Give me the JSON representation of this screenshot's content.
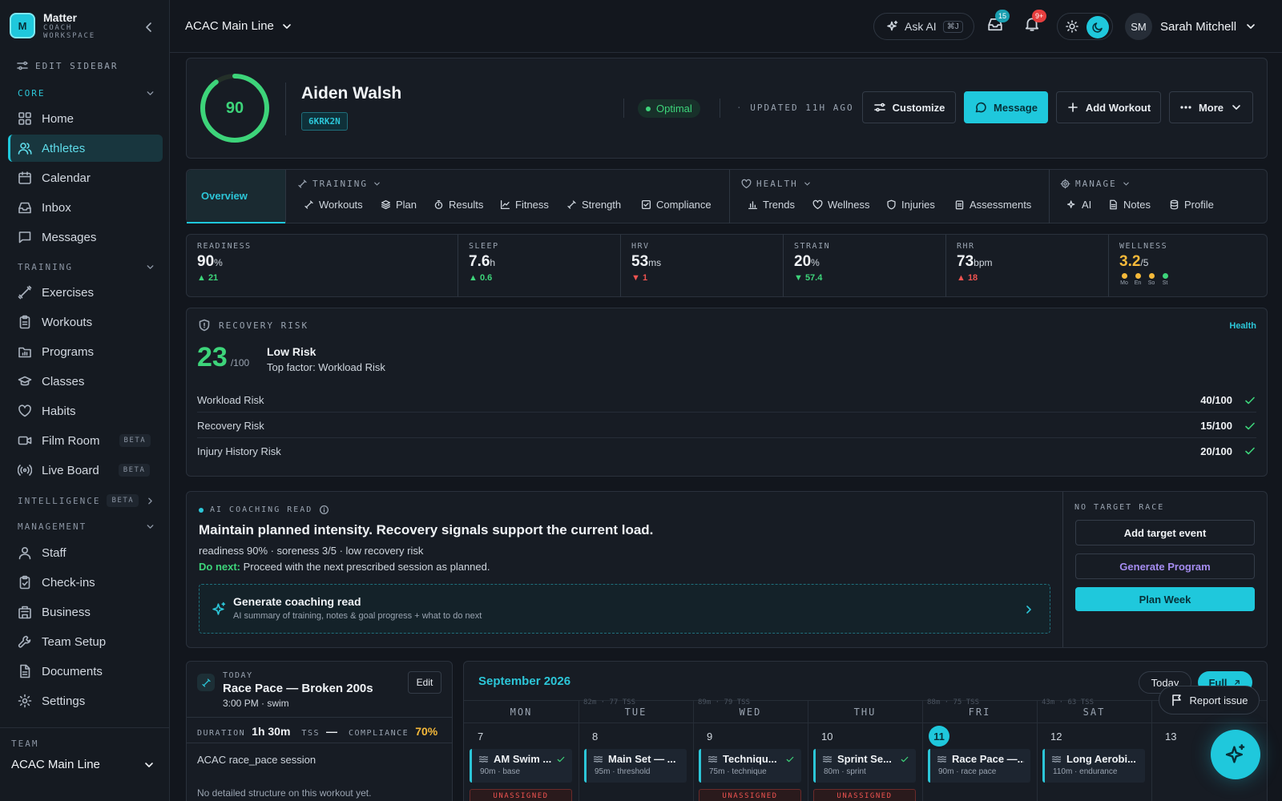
{
  "sidebar": {
    "brand": {
      "logo": "M",
      "name": "Matter",
      "sub1": "COACH",
      "sub2": "WORKSPACE"
    },
    "edit_label": "EDIT SIDEBAR",
    "sections": {
      "core": "CORE",
      "training": "TRAINING",
      "intelligence": "INTELLIGENCE",
      "management": "MANAGEMENT"
    },
    "beta": "BETA",
    "items": {
      "home": "Home",
      "athletes": "Athletes",
      "calendar": "Calendar",
      "inbox": "Inbox",
      "messages": "Messages",
      "exercises": "Exercises",
      "workouts": "Workouts",
      "programs": "Programs",
      "classes": "Classes",
      "habits": "Habits",
      "film_room": "Film Room",
      "live_board": "Live Board",
      "staff": "Staff",
      "checkins": "Check-ins",
      "business": "Business",
      "team_setup": "Team Setup",
      "documents": "Documents",
      "settings": "Settings"
    },
    "team_label": "TEAM",
    "team_value": "ACAC Main Line"
  },
  "topbar": {
    "context": "ACAC Main Line",
    "ask_ai": "Ask AI",
    "ask_ai_kbd": "⌘J",
    "inbox_badge": "15",
    "notif_badge": "9+",
    "user_initials": "SM",
    "user_name": "Sarah Mitchell"
  },
  "athlete": {
    "score": "90",
    "score_fraction": 0.9,
    "name": "Aiden Walsh",
    "id": "6KRK2N",
    "status": "Optimal",
    "updated": "UPDATED 11H AGO",
    "buttons": {
      "customize": "Customize",
      "message": "Message",
      "add_workout": "Add Workout",
      "more": "More"
    }
  },
  "tabs": {
    "overview": "Overview",
    "training": {
      "label": "TRAINING",
      "items": [
        "Workouts",
        "Plan",
        "Results",
        "Fitness",
        "Strength",
        "Compliance"
      ]
    },
    "health": {
      "label": "HEALTH",
      "items": [
        "Trends",
        "Wellness",
        "Injuries",
        "Assessments"
      ]
    },
    "manage": {
      "label": "MANAGE",
      "items": [
        "AI",
        "Notes",
        "Profile"
      ]
    }
  },
  "metrics": [
    {
      "label": "READINESS",
      "value": "90",
      "unit": "%",
      "delta": "▲ 21",
      "dir": "up"
    },
    {
      "label": "SLEEP",
      "value": "7.6",
      "unit": "h",
      "delta": "▲ 0.6",
      "dir": "up"
    },
    {
      "label": "HRV",
      "value": "53",
      "unit": "ms",
      "delta": "▼ 1",
      "dir": "down"
    },
    {
      "label": "STRAIN",
      "value": "20",
      "unit": "%",
      "delta": "▼ 57.4",
      "dir": "up"
    },
    {
      "label": "RHR",
      "value": "73",
      "unit": "bpm",
      "delta": "▲ 18",
      "dir": "down"
    },
    {
      "label": "WELLNESS",
      "value": "3.2",
      "unit": "/5",
      "dots": [
        "Mo",
        "En",
        "So",
        "St"
      ]
    }
  ],
  "colors": {
    "accent": "#1fc8dc",
    "good": "#3dd47a",
    "bad": "#ef5350",
    "warn": "#f5b93a",
    "purple": "#a58cf0"
  },
  "recovery": {
    "title": "RECOVERY RISK",
    "link": "Health",
    "score": "23",
    "max": "/100",
    "level": "Low Risk",
    "factor": "Top factor: Workload Risk",
    "rows": [
      {
        "label": "Workload Risk",
        "value": "40/100"
      },
      {
        "label": "Recovery Risk",
        "value": "15/100"
      },
      {
        "label": "Injury History Risk",
        "value": "20/100"
      }
    ]
  },
  "coaching": {
    "label": "AI COACHING READ",
    "headline": "Maintain planned intensity. Recovery signals support the current load.",
    "stats": "readiness 90% · soreness 3/5 · low recovery risk",
    "next_label": "Do next:",
    "next_text": "Proceed with the next prescribed session as planned.",
    "gen_title": "Generate coaching read",
    "gen_sub": "AI summary of training, notes & goal progress + what to do next",
    "side_label": "NO TARGET RACE",
    "add_target": "Add target event",
    "gen_program": "Generate Program",
    "plan_week": "Plan Week"
  },
  "today": {
    "label": "TODAY",
    "title": "Race Pace — Broken 200s",
    "time": "3:00 PM · swim",
    "edit": "Edit",
    "duration_label": "DURATION",
    "duration": "1h 30m",
    "tss_label": "TSS",
    "tss": "—",
    "compliance_label": "COMPLIANCE",
    "compliance": "70%",
    "session": "ACAC race_pace session",
    "empty": "No detailed structure on this workout yet."
  },
  "calendar": {
    "month": "September 2026",
    "today_btn": "Today",
    "full_btn": "Full",
    "report": "Report issue",
    "days": [
      "MON",
      "TUE",
      "WED",
      "THU",
      "FRI",
      "SAT",
      ""
    ],
    "dates": [
      "7",
      "8",
      "9",
      "10",
      "11",
      "12",
      "13"
    ],
    "faint": [
      "82m · 77 TSS",
      "89m · 79 TSS",
      "",
      "88m · 75 TSS",
      "43m · 63 TSS"
    ],
    "events": [
      {
        "title": "AM Swim ...",
        "sub": "90m · base"
      },
      {
        "title": "Main Set — ...",
        "sub": "95m · threshold"
      },
      {
        "title": "Techniqu...",
        "sub": "75m · technique"
      },
      {
        "title": "Sprint Se...",
        "sub": "80m · sprint"
      },
      {
        "title": "Race Pace —...",
        "sub": "90m · race pace"
      },
      {
        "title": "Long Aerobi...",
        "sub": "110m · endurance"
      }
    ],
    "unassigned": "UNASSIGNED"
  }
}
